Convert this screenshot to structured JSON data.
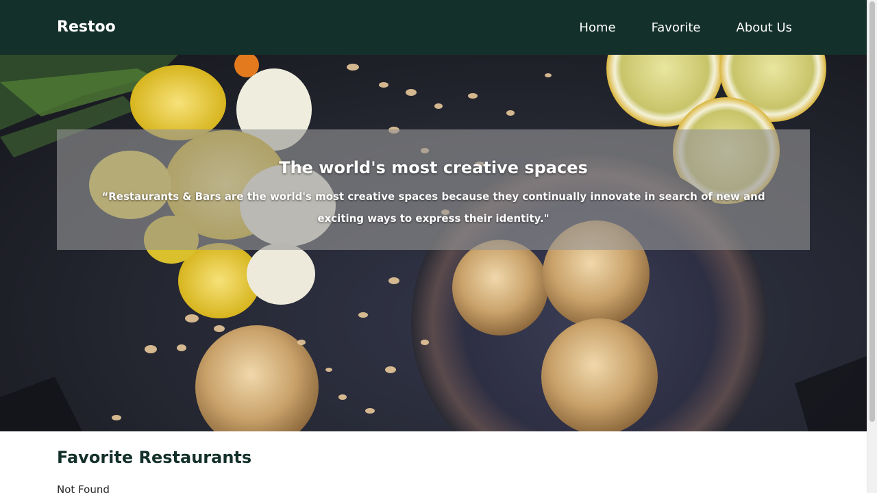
{
  "header": {
    "brand": "Restoo",
    "nav": [
      {
        "label": "Home"
      },
      {
        "label": "Favorite"
      },
      {
        "label": "About Us"
      }
    ]
  },
  "hero": {
    "title": "The world's most creative spaces",
    "quote": "“Restaurants & Bars are the world's most creative spaces because they continually innovate in search of new and exciting ways to express their identity.\""
  },
  "favorites": {
    "title": "Favorite Restaurants",
    "empty_text": "Not Found"
  },
  "colors": {
    "navbar_bg": "#14302a",
    "accent_text": "#14302a"
  }
}
